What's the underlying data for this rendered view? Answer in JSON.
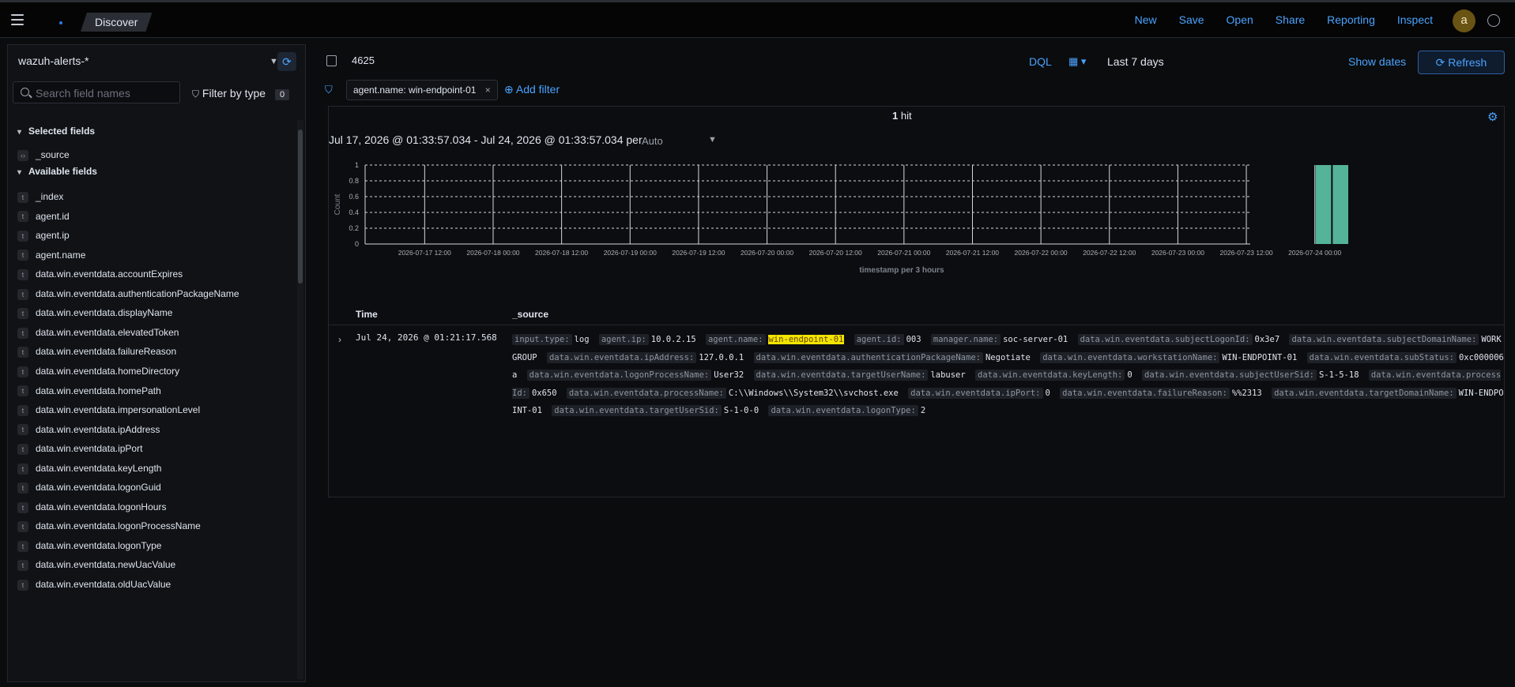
{
  "header": {
    "breadcrumb": "Discover",
    "links": [
      "New",
      "Save",
      "Open",
      "Share",
      "Reporting",
      "Inspect"
    ],
    "avatar": "a"
  },
  "sidebar": {
    "index_pattern": "wazuh-alerts-*",
    "search_placeholder": "Search field names",
    "filter_by_type": "Filter by type",
    "filter_count": "0",
    "selected_title": "Selected fields",
    "selected_fields": [
      "_source"
    ],
    "available_title": "Available fields",
    "available_fields": [
      "_index",
      "agent.id",
      "agent.ip",
      "agent.name",
      "data.win.eventdata.accountExpires",
      "data.win.eventdata.authenticationPackageName",
      "data.win.eventdata.displayName",
      "data.win.eventdata.elevatedToken",
      "data.win.eventdata.failureReason",
      "data.win.eventdata.homeDirectory",
      "data.win.eventdata.homePath",
      "data.win.eventdata.impersonationLevel",
      "data.win.eventdata.ipAddress",
      "data.win.eventdata.ipPort",
      "data.win.eventdata.keyLength",
      "data.win.eventdata.logonGuid",
      "data.win.eventdata.logonHours",
      "data.win.eventdata.logonProcessName",
      "data.win.eventdata.logonType",
      "data.win.eventdata.newUacValue",
      "data.win.eventdata.oldUacValue"
    ]
  },
  "query": {
    "text": "4625",
    "language": "DQL",
    "time_range": "Last 7 days",
    "show_dates": "Show dates",
    "refresh": "Refresh"
  },
  "filters": {
    "pill": "agent.name: win-endpoint-01",
    "add": "Add filter"
  },
  "results": {
    "hits_count": "1",
    "hits_label": "hit",
    "date_range": "Jul 17, 2026 @ 01:33:57.034 - Jul 24, 2026 @ 01:33:57.034 per",
    "interval": "Auto",
    "col_time": "Time",
    "col_source": "_source",
    "row": {
      "time": "Jul 24, 2026 @ 01:21:17.568",
      "fields": [
        {
          "k": "input.type:",
          "v": "log"
        },
        {
          "k": "agent.ip:",
          "v": "10.0.2.15"
        },
        {
          "k": "agent.name:",
          "v": "win-endpoint-01",
          "hl": true
        },
        {
          "k": "agent.id:",
          "v": "003"
        },
        {
          "k": "manager.name:",
          "v": "soc-server-01"
        },
        {
          "k": "data.win.eventdata.subjectLogonId:",
          "v": "0x3e7"
        },
        {
          "k": "data.win.eventdata.subjectDomainName:",
          "v": "WORKGROUP"
        },
        {
          "k": "data.win.eventdata.ipAddress:",
          "v": "127.0.0.1"
        },
        {
          "k": "data.win.eventdata.authenticationPackageName:",
          "v": "Negotiate"
        },
        {
          "k": "data.win.eventdata.workstationName:",
          "v": "WIN-ENDPOINT-01"
        },
        {
          "k": "data.win.eventdata.subStatus:",
          "v": "0xc000006a"
        },
        {
          "k": "data.win.eventdata.logonProcessName:",
          "v": "User32"
        },
        {
          "k": "data.win.eventdata.targetUserName:",
          "v": "labuser"
        },
        {
          "k": "data.win.eventdata.keyLength:",
          "v": "0"
        },
        {
          "k": "data.win.eventdata.subjectUserSid:",
          "v": "S-1-5-18"
        },
        {
          "k": "data.win.eventdata.processId:",
          "v": "0x650"
        },
        {
          "k": "data.win.eventdata.processName:",
          "v": "C:\\\\Windows\\\\System32\\\\svchost.exe"
        },
        {
          "k": "data.win.eventdata.ipPort:",
          "v": "0"
        },
        {
          "k": "data.win.eventdata.failureReason:",
          "v": "%%2313"
        },
        {
          "k": "data.win.eventdata.targetDomainName:",
          "v": "WIN-ENDPOINT-01"
        },
        {
          "k": "data.win.eventdata.targetUserSid:",
          "v": "S-1-0-0"
        },
        {
          "k": "data.win.eventdata.logonType:",
          "v": "2"
        }
      ]
    }
  },
  "chart_data": {
    "type": "bar",
    "xlabel": "timestamp per 3 hours",
    "ylabel": "Count",
    "ylim": [
      0,
      1
    ],
    "y_ticks": [
      "0",
      "0.2",
      "0.4",
      "0.6",
      "0.8",
      "1"
    ],
    "x_ticks": [
      "2026-07-17 12:00",
      "2026-07-18 00:00",
      "2026-07-18 12:00",
      "2026-07-19 00:00",
      "2026-07-19 12:00",
      "2026-07-20 00:00",
      "2026-07-20 12:00",
      "2026-07-21 00:00",
      "2026-07-21 12:00",
      "2026-07-22 00:00",
      "2026-07-22 12:00",
      "2026-07-23 00:00",
      "2026-07-23 12:00",
      "2026-07-24 00:00"
    ],
    "bars": [
      {
        "x": "2026-07-24 00:00",
        "value": 1
      },
      {
        "x": "2026-07-24 03:00",
        "value": 1
      }
    ],
    "bar_color": "#54b399",
    "grid": true
  }
}
